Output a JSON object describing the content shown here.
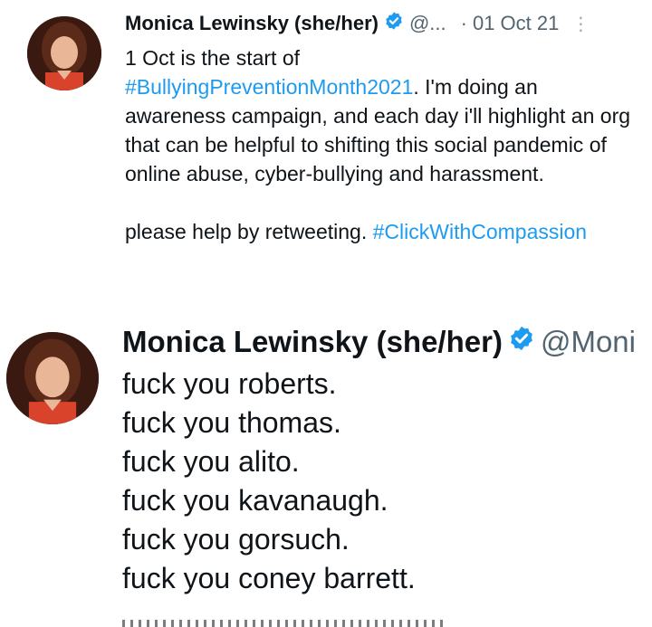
{
  "tweet1": {
    "author_name": "Monica Lewinsky (she/her)",
    "handle": "@...",
    "separator": "·",
    "date": "01 Oct 21",
    "more_glyph": "⋮",
    "line1_text": "1 Oct is the start of",
    "hashtag1": "#BullyingPreventionMonth2021",
    "line2_rest": ". I'm doing an awareness campaign, and each day i'll highlight an org that can be helpful to shifting this social pandemic of online abuse, cyber-bullying and harassment.",
    "line3_text": "please help by retweeting. ",
    "hashtag2": "#ClickWithCompassion"
  },
  "tweet2": {
    "author_name": "Monica Lewinsky (she/her)",
    "handle": "@Moni",
    "lines": [
      "fuck you roberts.",
      "fuck you thomas.",
      "fuck you alito.",
      "fuck you kavanaugh.",
      "fuck you gorsuch.",
      "fuck you coney barrett."
    ]
  },
  "colors": {
    "hashtag": "#1d9bf0",
    "verified": "#1d9bf0",
    "secondary_text": "#536471",
    "primary_text": "#0f1419"
  },
  "icons": {
    "verified": "verified-badge-icon",
    "more": "more-options-icon"
  }
}
